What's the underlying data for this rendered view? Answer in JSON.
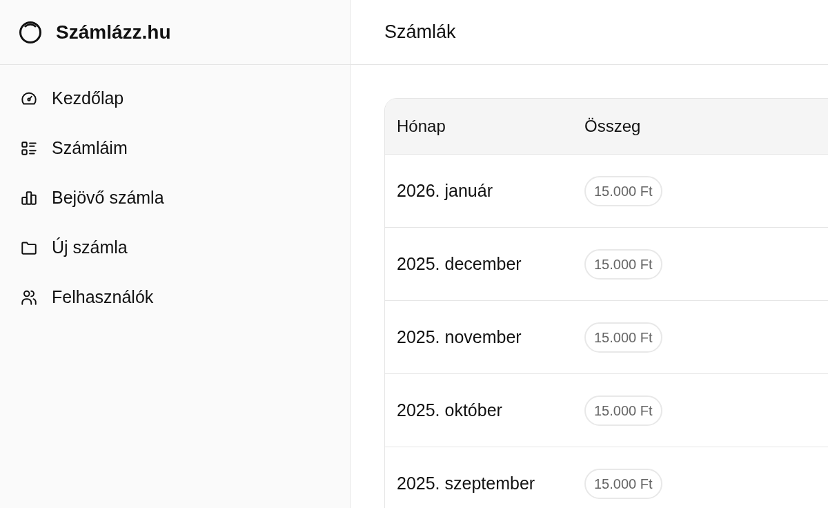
{
  "sidebar": {
    "brand": "Számlázz.hu",
    "items": [
      {
        "label": "Kezdőlap"
      },
      {
        "label": "Számláim"
      },
      {
        "label": "Bejövő számla"
      },
      {
        "label": "Új számla"
      },
      {
        "label": "Felhasználók"
      }
    ]
  },
  "page_title": "Számlák",
  "table": {
    "columns": [
      "Hónap",
      "Összeg"
    ],
    "rows": [
      {
        "month": "2026. január",
        "amount": "15.000 Ft"
      },
      {
        "month": "2025. december",
        "amount": "15.000 Ft"
      },
      {
        "month": "2025. november",
        "amount": "15.000 Ft"
      },
      {
        "month": "2025. október",
        "amount": "15.000 Ft"
      },
      {
        "month": "2025. szeptember",
        "amount": "15.000 Ft"
      }
    ]
  }
}
